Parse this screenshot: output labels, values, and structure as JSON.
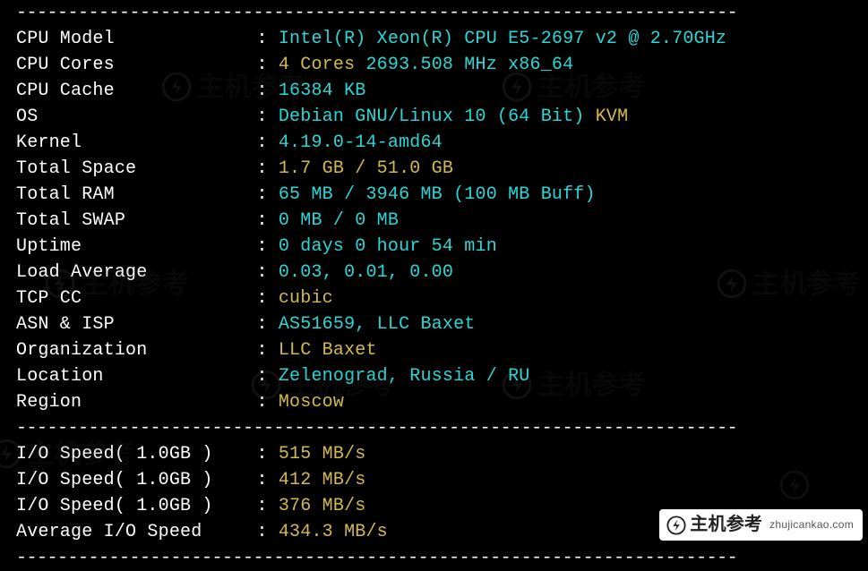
{
  "divider": "----------------------------------------------------------------------",
  "info": [
    {
      "label": "CPU Model",
      "value": "Intel(R) Xeon(R) CPU E5-2697 v2 @ 2.70GHz",
      "color": "c"
    },
    {
      "label": "CPU Cores",
      "segments": [
        {
          "t": "4 Cores ",
          "c": "y"
        },
        {
          "t": "2693.508 MHz x86_64",
          "c": "c"
        }
      ]
    },
    {
      "label": "CPU Cache",
      "value": "16384 KB",
      "color": "c"
    },
    {
      "label": "OS",
      "segments": [
        {
          "t": "Debian GNU/Linux 10 (64 Bit) ",
          "c": "c"
        },
        {
          "t": "KVM",
          "c": "y"
        }
      ]
    },
    {
      "label": "Kernel",
      "value": "4.19.0-14-amd64",
      "color": "c"
    },
    {
      "label": "Total Space",
      "value": "1.7 GB / 51.0 GB",
      "color": "y"
    },
    {
      "label": "Total RAM",
      "value": "65 MB / 3946 MB (100 MB Buff)",
      "color": "c"
    },
    {
      "label": "Total SWAP",
      "value": "0 MB / 0 MB",
      "color": "c"
    },
    {
      "label": "Uptime",
      "value": "0 days 0 hour 54 min",
      "color": "c"
    },
    {
      "label": "Load Average",
      "value": "0.03, 0.01, 0.00",
      "color": "c"
    },
    {
      "label": "TCP CC",
      "value": "cubic",
      "color": "y"
    },
    {
      "label": "ASN & ISP",
      "value": "AS51659, LLC Baxet",
      "color": "c"
    },
    {
      "label": "Organization",
      "value": "LLC Baxet",
      "color": "y"
    },
    {
      "label": "Location",
      "value": "Zelenograd, Russia / RU",
      "color": "c"
    },
    {
      "label": "Region",
      "value": "Moscow",
      "color": "y"
    }
  ],
  "io_label": "I/O Speed( 1.0GB )",
  "io_avg_label": "Average I/O Speed",
  "io": [
    {
      "value": "515 MB/s"
    },
    {
      "value": "412 MB/s"
    },
    {
      "value": "376 MB/s"
    }
  ],
  "io_avg_value": "434.3 MB/s",
  "watermark": {
    "brand": "主机参考",
    "url": "zhujicankao.com"
  }
}
